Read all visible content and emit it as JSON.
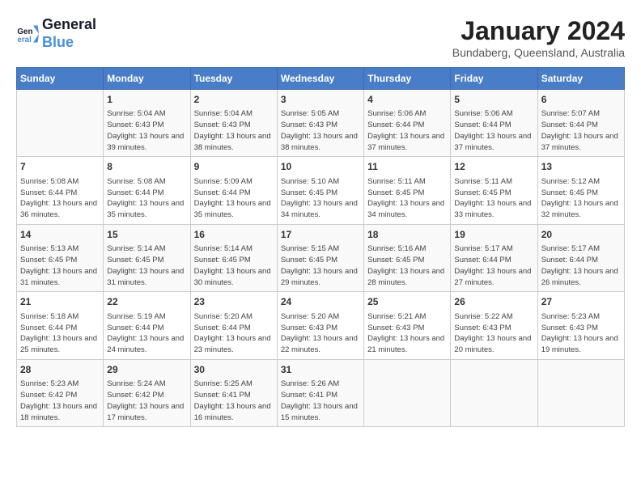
{
  "header": {
    "logo_line1": "General",
    "logo_line2": "Blue",
    "month_year": "January 2024",
    "location": "Bundaberg, Queensland, Australia"
  },
  "columns": [
    "Sunday",
    "Monday",
    "Tuesday",
    "Wednesday",
    "Thursday",
    "Friday",
    "Saturday"
  ],
  "weeks": [
    [
      {
        "day": "",
        "sunrise": "",
        "sunset": "",
        "daylight": ""
      },
      {
        "day": "1",
        "sunrise": "5:04 AM",
        "sunset": "6:43 PM",
        "daylight": "13 hours and 39 minutes."
      },
      {
        "day": "2",
        "sunrise": "5:04 AM",
        "sunset": "6:43 PM",
        "daylight": "13 hours and 38 minutes."
      },
      {
        "day": "3",
        "sunrise": "5:05 AM",
        "sunset": "6:43 PM",
        "daylight": "13 hours and 38 minutes."
      },
      {
        "day": "4",
        "sunrise": "5:06 AM",
        "sunset": "6:44 PM",
        "daylight": "13 hours and 37 minutes."
      },
      {
        "day": "5",
        "sunrise": "5:06 AM",
        "sunset": "6:44 PM",
        "daylight": "13 hours and 37 minutes."
      },
      {
        "day": "6",
        "sunrise": "5:07 AM",
        "sunset": "6:44 PM",
        "daylight": "13 hours and 37 minutes."
      }
    ],
    [
      {
        "day": "7",
        "sunrise": "5:08 AM",
        "sunset": "6:44 PM",
        "daylight": "13 hours and 36 minutes."
      },
      {
        "day": "8",
        "sunrise": "5:08 AM",
        "sunset": "6:44 PM",
        "daylight": "13 hours and 35 minutes."
      },
      {
        "day": "9",
        "sunrise": "5:09 AM",
        "sunset": "6:44 PM",
        "daylight": "13 hours and 35 minutes."
      },
      {
        "day": "10",
        "sunrise": "5:10 AM",
        "sunset": "6:45 PM",
        "daylight": "13 hours and 34 minutes."
      },
      {
        "day": "11",
        "sunrise": "5:11 AM",
        "sunset": "6:45 PM",
        "daylight": "13 hours and 34 minutes."
      },
      {
        "day": "12",
        "sunrise": "5:11 AM",
        "sunset": "6:45 PM",
        "daylight": "13 hours and 33 minutes."
      },
      {
        "day": "13",
        "sunrise": "5:12 AM",
        "sunset": "6:45 PM",
        "daylight": "13 hours and 32 minutes."
      }
    ],
    [
      {
        "day": "14",
        "sunrise": "5:13 AM",
        "sunset": "6:45 PM",
        "daylight": "13 hours and 31 minutes."
      },
      {
        "day": "15",
        "sunrise": "5:14 AM",
        "sunset": "6:45 PM",
        "daylight": "13 hours and 31 minutes."
      },
      {
        "day": "16",
        "sunrise": "5:14 AM",
        "sunset": "6:45 PM",
        "daylight": "13 hours and 30 minutes."
      },
      {
        "day": "17",
        "sunrise": "5:15 AM",
        "sunset": "6:45 PM",
        "daylight": "13 hours and 29 minutes."
      },
      {
        "day": "18",
        "sunrise": "5:16 AM",
        "sunset": "6:45 PM",
        "daylight": "13 hours and 28 minutes."
      },
      {
        "day": "19",
        "sunrise": "5:17 AM",
        "sunset": "6:44 PM",
        "daylight": "13 hours and 27 minutes."
      },
      {
        "day": "20",
        "sunrise": "5:17 AM",
        "sunset": "6:44 PM",
        "daylight": "13 hours and 26 minutes."
      }
    ],
    [
      {
        "day": "21",
        "sunrise": "5:18 AM",
        "sunset": "6:44 PM",
        "daylight": "13 hours and 25 minutes."
      },
      {
        "day": "22",
        "sunrise": "5:19 AM",
        "sunset": "6:44 PM",
        "daylight": "13 hours and 24 minutes."
      },
      {
        "day": "23",
        "sunrise": "5:20 AM",
        "sunset": "6:44 PM",
        "daylight": "13 hours and 23 minutes."
      },
      {
        "day": "24",
        "sunrise": "5:20 AM",
        "sunset": "6:43 PM",
        "daylight": "13 hours and 22 minutes."
      },
      {
        "day": "25",
        "sunrise": "5:21 AM",
        "sunset": "6:43 PM",
        "daylight": "13 hours and 21 minutes."
      },
      {
        "day": "26",
        "sunrise": "5:22 AM",
        "sunset": "6:43 PM",
        "daylight": "13 hours and 20 minutes."
      },
      {
        "day": "27",
        "sunrise": "5:23 AM",
        "sunset": "6:43 PM",
        "daylight": "13 hours and 19 minutes."
      }
    ],
    [
      {
        "day": "28",
        "sunrise": "5:23 AM",
        "sunset": "6:42 PM",
        "daylight": "13 hours and 18 minutes."
      },
      {
        "day": "29",
        "sunrise": "5:24 AM",
        "sunset": "6:42 PM",
        "daylight": "13 hours and 17 minutes."
      },
      {
        "day": "30",
        "sunrise": "5:25 AM",
        "sunset": "6:41 PM",
        "daylight": "13 hours and 16 minutes."
      },
      {
        "day": "31",
        "sunrise": "5:26 AM",
        "sunset": "6:41 PM",
        "daylight": "13 hours and 15 minutes."
      },
      {
        "day": "",
        "sunrise": "",
        "sunset": "",
        "daylight": ""
      },
      {
        "day": "",
        "sunrise": "",
        "sunset": "",
        "daylight": ""
      },
      {
        "day": "",
        "sunrise": "",
        "sunset": "",
        "daylight": ""
      }
    ]
  ]
}
